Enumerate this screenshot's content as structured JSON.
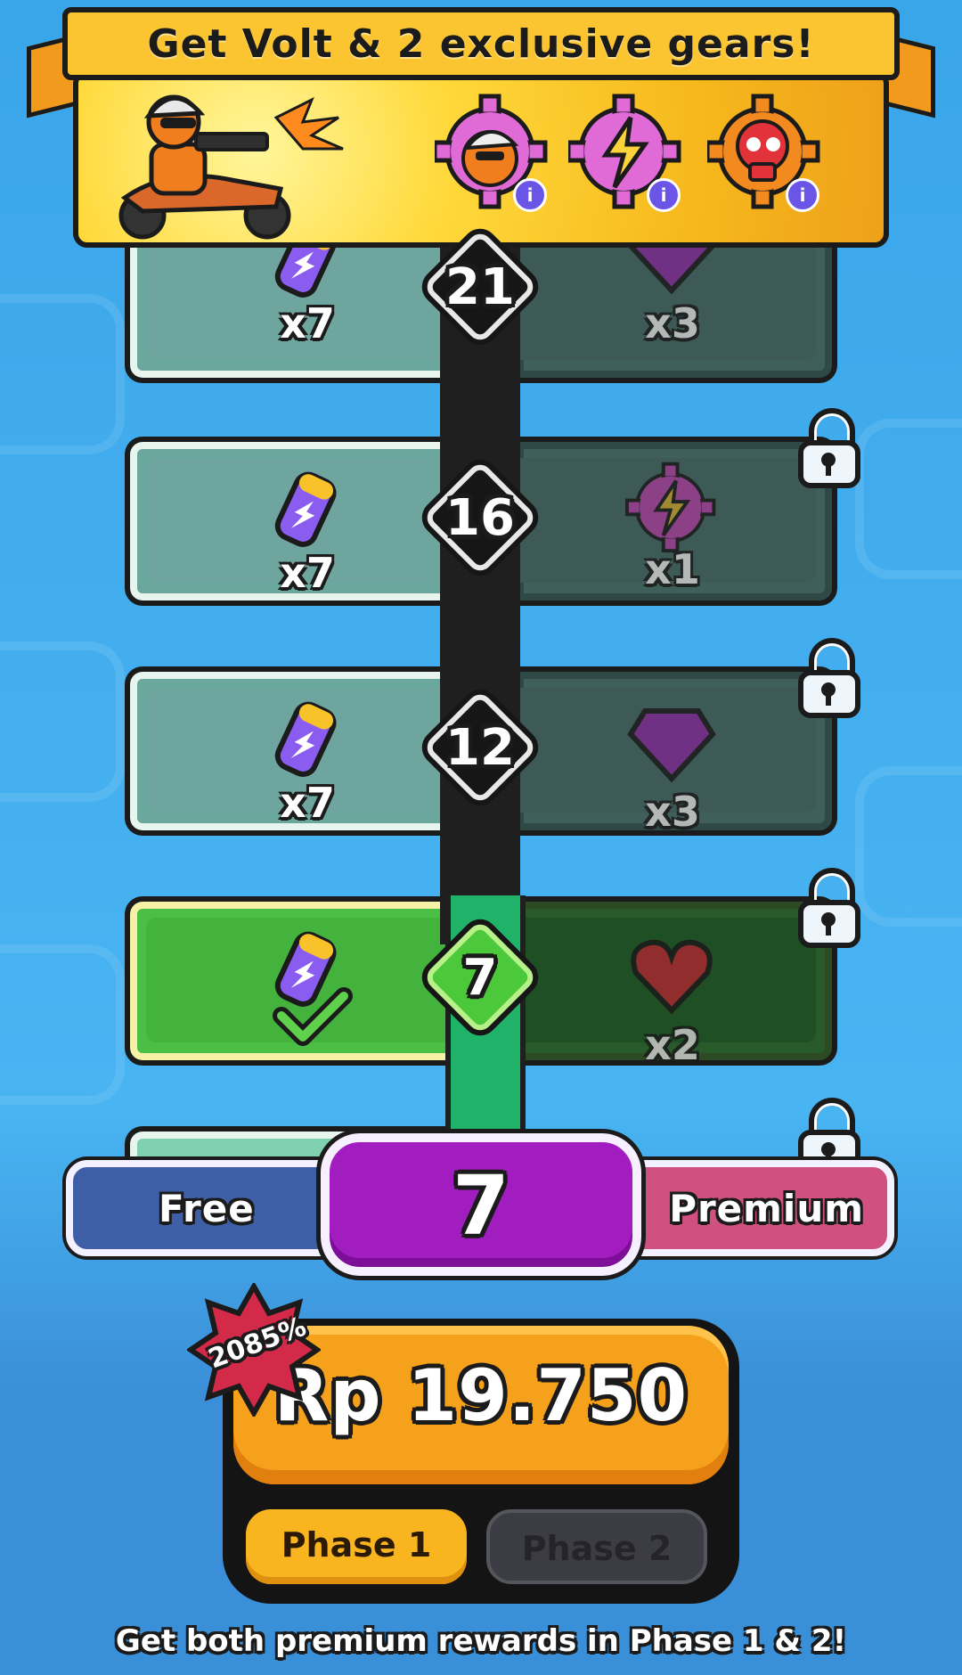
{
  "banner": {
    "title": "Get Volt & 2 exclusive gears!",
    "gears": [
      {
        "icon": "volt-gear-icon",
        "color": "#e06ad6",
        "info": "i"
      },
      {
        "icon": "lightning-gear-icon",
        "color": "#e06ad6",
        "info": "i"
      },
      {
        "icon": "skull-gear-icon",
        "color": "#f28a1f",
        "info": "i"
      }
    ]
  },
  "tiers": [
    {
      "level": "21",
      "free": {
        "icon": "battery-icon",
        "qty": "x7"
      },
      "premium": {
        "icon": "gem-icon",
        "qty": "x3"
      },
      "locked": true
    },
    {
      "level": "16",
      "free": {
        "icon": "battery-icon",
        "qty": "x7"
      },
      "premium": {
        "icon": "lightning-gear-icon",
        "qty": "x1"
      },
      "locked": true
    },
    {
      "level": "12",
      "free": {
        "icon": "battery-icon",
        "qty": "x7"
      },
      "premium": {
        "icon": "gem-icon",
        "qty": "x3"
      },
      "locked": true
    },
    {
      "level": "7",
      "free": {
        "icon": "battery-icon",
        "qty": "",
        "claimed": true
      },
      "premium": {
        "icon": "heart-icon",
        "qty": "x2"
      },
      "locked": true
    }
  ],
  "toggle": {
    "free_label": "Free",
    "current_level": "7",
    "premium_label": "Premium"
  },
  "purchase": {
    "discount": "2085%",
    "price": "Rp 19.750"
  },
  "phases": [
    {
      "label": "Phase 1",
      "active": true
    },
    {
      "label": "Phase 2",
      "active": false
    }
  ],
  "footer": "Get both premium rewards in Phase 1 & 2!",
  "colors": {
    "accent": "#a11dc0",
    "buy": "#f6a11b",
    "free": "#3e5ea6",
    "premium": "#d0507f",
    "track_fill": "#1fb268"
  }
}
